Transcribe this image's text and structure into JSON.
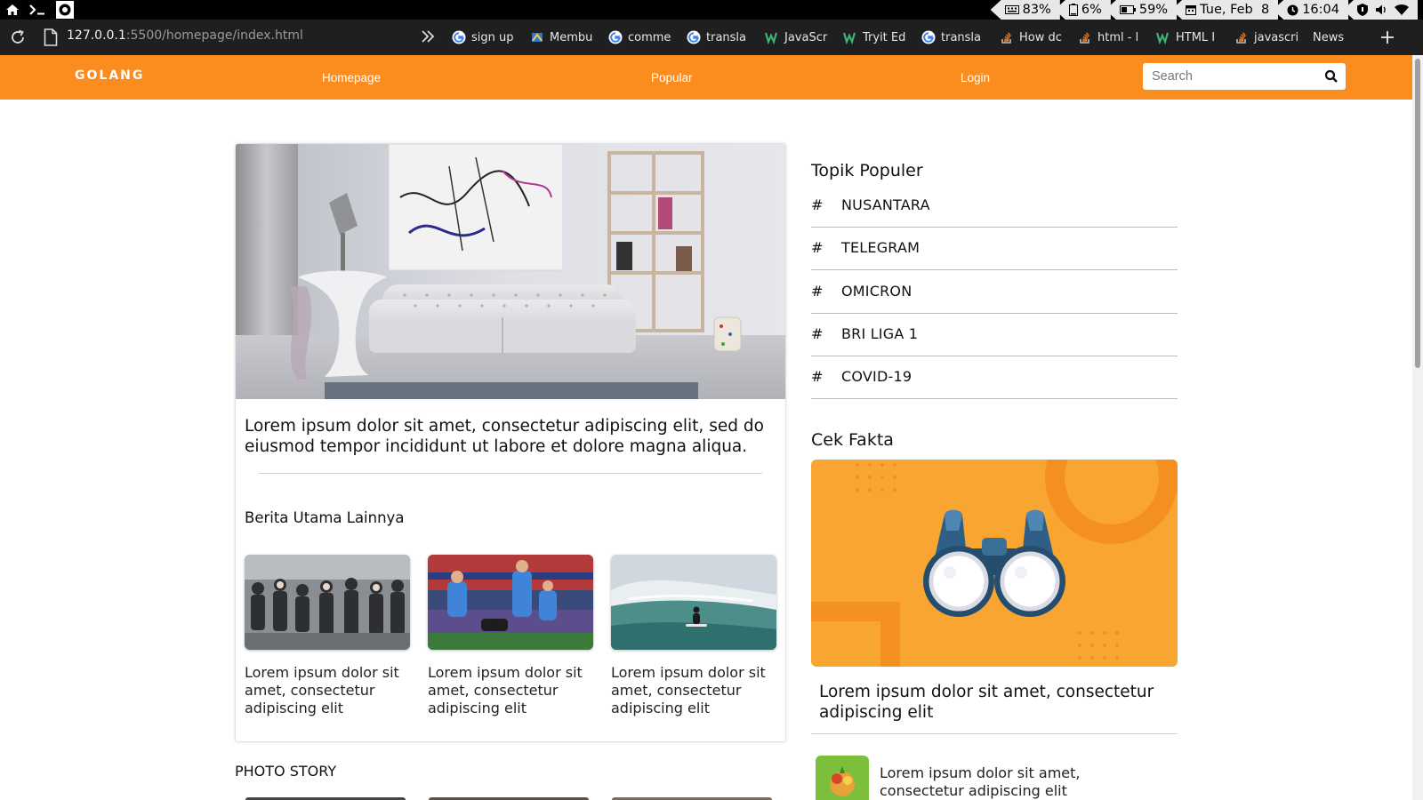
{
  "system_bar": {
    "keyboard_battery": "83%",
    "battery": "6%",
    "second_battery": "59%",
    "date": "Tue, Feb  8",
    "time": "16:04"
  },
  "browser": {
    "url_host": "127.0.0.1",
    "url_rest": ":5500/homepage/index.html",
    "bookmarks": [
      {
        "label": "sign up",
        "icon": "google-icon"
      },
      {
        "label": "Membu",
        "icon": "site-icon"
      },
      {
        "label": "comme",
        "icon": "google-icon"
      },
      {
        "label": "transla",
        "icon": "google-icon"
      },
      {
        "label": "JavaScr",
        "icon": "w3schools-icon"
      },
      {
        "label": "Tryit Ed",
        "icon": "w3schools-icon"
      },
      {
        "label": "transla",
        "icon": "google-icon"
      },
      {
        "label": "How dc",
        "icon": "stackoverflow-icon"
      },
      {
        "label": "html - l",
        "icon": "stackoverflow-icon"
      },
      {
        "label": "HTML I",
        "icon": "w3schools-icon"
      },
      {
        "label": "javascri",
        "icon": "stackoverflow-icon"
      },
      {
        "label": "News",
        "icon": ""
      }
    ]
  },
  "nav": {
    "brand": "GOLANG",
    "links": [
      "Homepage",
      "Popular",
      "Login"
    ],
    "search_placeholder": "Search",
    "accent": "#fb8c1e"
  },
  "main": {
    "hero_title_line1": "Lorem ipsum dolor sit amet, consectetur adipiscing elit, sed do",
    "hero_title_line2": "eiusmod tempor incididunt ut labore et dolore magna aliqua.",
    "section_title": "Berita Utama Lainnya",
    "articles": [
      {
        "caption": "Lorem ipsum dolor sit amet, consectetur adipiscing elit"
      },
      {
        "caption": "Lorem ipsum dolor sit amet, consectetur adipiscing elit"
      },
      {
        "caption": "Lorem ipsum dolor sit amet, consectetur adipiscing elit"
      }
    ],
    "photo_story": "PHOTO STORY"
  },
  "sidebar": {
    "topics_title": "Topik Populer",
    "topic_symbol": "#",
    "topics": [
      "NUSANTARA",
      "TELEGRAM",
      "OMICRON",
      "BRI LIGA 1",
      "COVID-19"
    ],
    "fact_title": "Cek Fakta",
    "fact_headline": "Lorem ipsum dolor sit amet, consectetur adipiscing elit",
    "fact_item": "Lorem ipsum dolor sit amet, consectetur adipiscing elit"
  }
}
